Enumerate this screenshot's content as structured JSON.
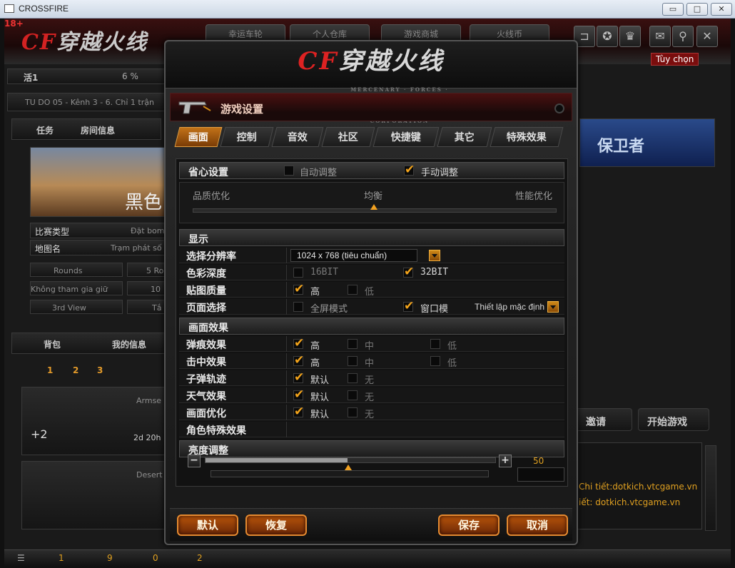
{
  "window": {
    "title": "CROSSFIRE",
    "min_symbol": "▭",
    "max_symbol": "□",
    "close_symbol": "✕"
  },
  "background": {
    "badge": "18+",
    "logo_text": "穿越火线",
    "top_tabs": [
      "幸运车轮",
      "个人仓库",
      "游戏商城",
      "火线币"
    ],
    "top_icons": [
      "bug-icon",
      "badge-icon",
      "trophy-icon",
      "mail-icon",
      "wrench-icon",
      "close-icon"
    ],
    "tuy_chon": "Tùy chọn",
    "level_label": "活1",
    "level_pct": "6 %",
    "server_line": "TU DO 05 - Kênh 3 - 6. Chỉ 1 trận",
    "room_tabs": [
      "任务",
      "房间信息"
    ],
    "map_label": "黑色",
    "match_type_label": "比赛类型",
    "match_type_value": "Đặt bom",
    "map_name_label": "地图名",
    "map_name_value": "Trạm phát số",
    "rounds": "Rounds",
    "rounds_value": "5 Ro",
    "join_mode": "Không tham gia giữ",
    "join_value": "10",
    "view": "3rd View",
    "view_value": "Tắ",
    "bag_tabs": [
      "背包",
      "我的信息"
    ],
    "pages": [
      "1",
      "2",
      "3"
    ],
    "item1_name": "Armse",
    "item1_time": "2d 20h",
    "item1_plus": "+2",
    "item2_name": "Desert",
    "banner": "保卫者",
    "invite_button": "邀请",
    "start_button": "开始游戏",
    "chat_line1": "Chi tiết:dotkich.vtcgame.vn",
    "chat_line2": "iết: dotkich.vtcgame.vn",
    "status_items": [
      "1",
      "9",
      "0",
      "2"
    ]
  },
  "dialog": {
    "logo": "穿越火线",
    "logo_sub": "MERCENARY · FORCES · CORPORATION",
    "title": "游戏设置",
    "tabs": [
      "画面",
      "控制",
      "音效",
      "社区",
      "快捷键",
      "其它",
      "特殊效果"
    ],
    "active_tab": "画面",
    "worry_free": {
      "label": "省心设置",
      "auto": "自动调整",
      "manual": "手动调整",
      "auto_checked": false,
      "manual_checked": true,
      "quality": "品质优化",
      "balance": "均衡",
      "performance": "性能优化",
      "slider_level": 0.5
    },
    "display": {
      "header": "显示",
      "resolution_label": "选择分辨率",
      "resolution_value": "1024 x 768 (tiêu chuẩn)",
      "color_label": "色彩深度",
      "color_16": "16BIT",
      "color_32": "32BIT",
      "texture_label": "贴图质量",
      "texture_high": "高",
      "texture_low": "低",
      "page_label": "页面选择",
      "fullscreen": "全屏模式",
      "windowed": "窗口模",
      "preset": "Thiết lập mặc định"
    },
    "effects": {
      "header": "画面效果",
      "bullet_mark_label": "弹痕效果",
      "hit_label": "击中效果",
      "trail_label": "子弹轨迹",
      "weather_label": "天气效果",
      "optimize_label": "画面优化",
      "char_label": "角色特殊效果",
      "high": "高",
      "mid": "中",
      "low": "低",
      "default": "默认",
      "none": "无"
    },
    "brightness": {
      "label": "亮度调整",
      "minus": "−",
      "plus": "+",
      "value": "50",
      "level": 0.5
    },
    "buttons": {
      "default": "默认",
      "restore": "恢复",
      "save": "保存",
      "cancel": "取消"
    }
  }
}
